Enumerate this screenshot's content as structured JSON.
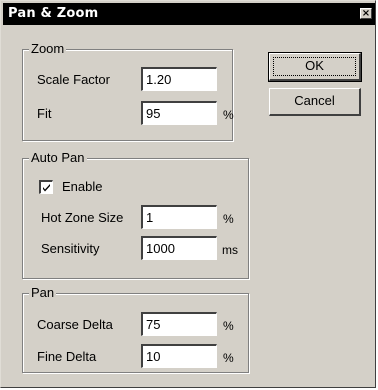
{
  "window": {
    "title": "Pan & Zoom",
    "close_glyph": "×"
  },
  "zoom": {
    "legend": "Zoom",
    "scale_factor": {
      "label": "Scale Factor",
      "value": "1.20"
    },
    "fit": {
      "label": "Fit",
      "value": "95",
      "unit": "%"
    }
  },
  "auto_pan": {
    "legend": "Auto Pan",
    "enable": {
      "label": "Enable",
      "checked": true
    },
    "hot_zone_size": {
      "label": "Hot Zone Size",
      "value": "1",
      "unit": "%"
    },
    "sensitivity": {
      "label": "Sensitivity",
      "value": "1000",
      "unit": "ms"
    }
  },
  "pan": {
    "legend": "Pan",
    "coarse_delta": {
      "label": "Coarse Delta",
      "value": "75",
      "unit": "%"
    },
    "fine_delta": {
      "label": "Fine Delta",
      "value": "10",
      "unit": "%"
    }
  },
  "buttons": {
    "ok": "OK",
    "cancel": "Cancel"
  },
  "colors": {
    "dialog_bg": "#d4d0c8",
    "titlebar_bg": "#000000",
    "title_fg": "#ffffff"
  }
}
